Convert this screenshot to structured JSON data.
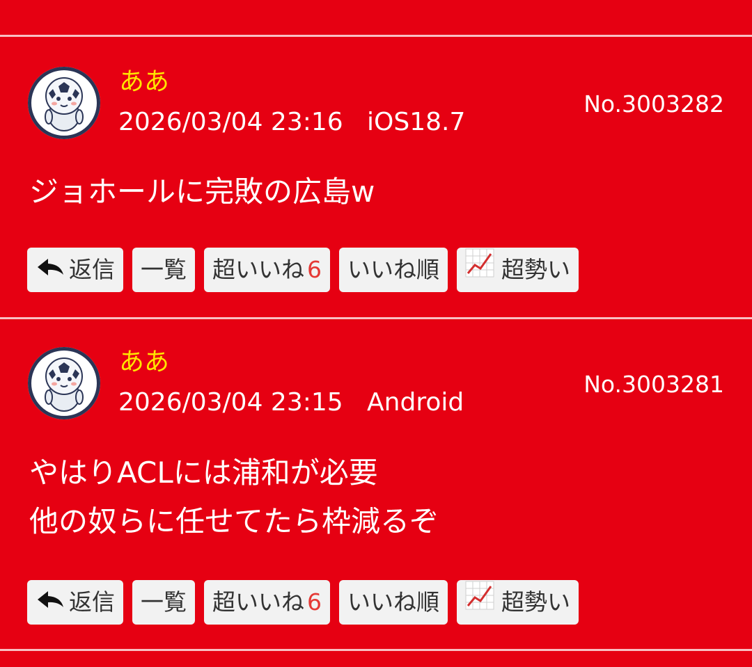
{
  "posts": [
    {
      "user": "ああ",
      "datetime": "2026/03/04 23:16",
      "device": "iOS18.7",
      "number": "No.3003282",
      "lines": [
        "ジョホールに完敗の広島w"
      ],
      "actions": {
        "reply": "返信",
        "list": "一覧",
        "super_like": "超いいね",
        "super_like_count": "6",
        "likes_order": "いいね順",
        "trending": "超勢い"
      }
    },
    {
      "user": "ああ",
      "datetime": "2026/03/04 23:15",
      "device": "Android",
      "number": "No.3003281",
      "lines": [
        "やはりACLには浦和が必要",
        "他の奴らに任せてたら枠減るぞ"
      ],
      "actions": {
        "reply": "返信",
        "list": "一覧",
        "super_like": "超いいね",
        "super_like_count": "6",
        "likes_order": "いいね順",
        "trending": "超勢い"
      }
    }
  ],
  "icons": {
    "avatar": "soccer-mascot-avatar",
    "reply": "reply-arrow-icon",
    "trending": "chart-up-icon"
  },
  "colors": {
    "background": "#e60012",
    "username": "#ffe600",
    "count": "#e53935",
    "button": "#f2f2f2"
  }
}
